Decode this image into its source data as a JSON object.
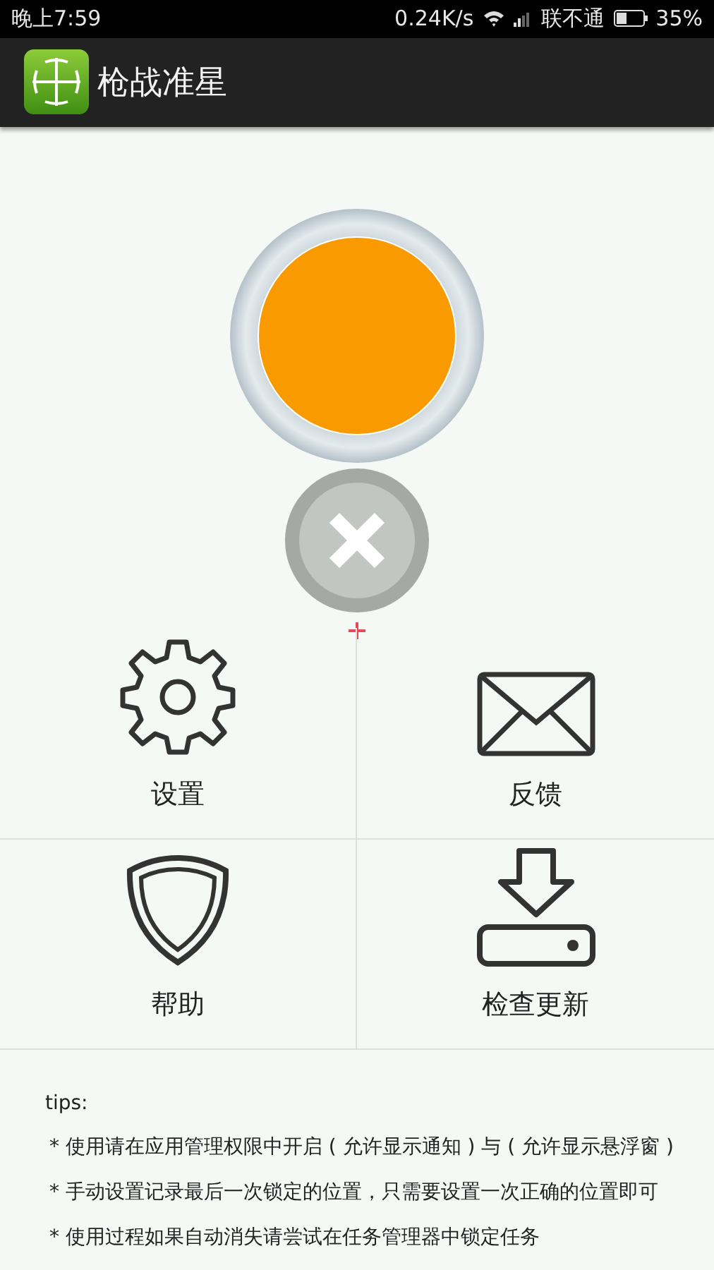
{
  "status_bar": {
    "time": "晚上7:59",
    "speed": "0.24K/s",
    "carrier": "联不通",
    "battery": "35%"
  },
  "app_bar": {
    "title": "枪战准星"
  },
  "grid": [
    {
      "label": "设置"
    },
    {
      "label": "反馈"
    },
    {
      "label": "帮助"
    },
    {
      "label": "检查更新"
    }
  ],
  "tips": {
    "heading": "tips:",
    "lines": [
      "* 使用请在应用管理权限中开启 ( 允许显示通知 ) 与 ( 允许显示悬浮窗 )",
      "* 手动设置记录最后一次锁定的位置，只需要设置一次正确的位置即可",
      "* 使用过程如果自动消失请尝试在任务管理器中锁定任务"
    ]
  }
}
